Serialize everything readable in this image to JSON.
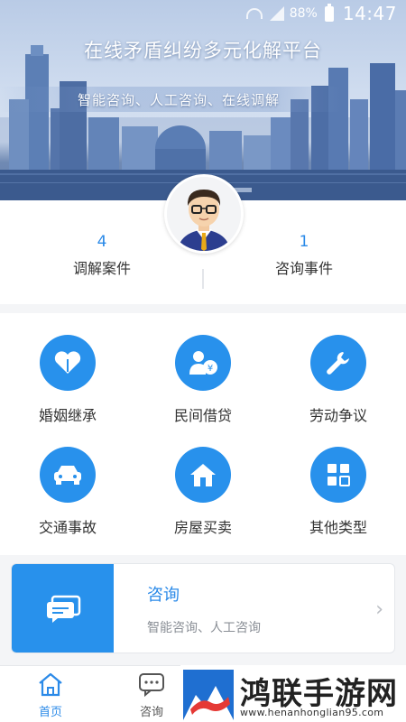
{
  "status_bar": {
    "battery_percent": "88%",
    "time": "14:47"
  },
  "hero": {
    "title": "在线矛盾纠纷多元化解平台",
    "subtitle": "智能咨询、人工咨询、在线调解"
  },
  "stats": {
    "left": {
      "value": "4",
      "label": "调解案件"
    },
    "right": {
      "value": "1",
      "label": "咨询事件"
    }
  },
  "categories": [
    {
      "label": "婚姻继承",
      "icon": "heart-icon"
    },
    {
      "label": "民间借贷",
      "icon": "user-loan-icon"
    },
    {
      "label": "劳动争议",
      "icon": "wrench-icon"
    },
    {
      "label": "交通事故",
      "icon": "car-icon"
    },
    {
      "label": "房屋买卖",
      "icon": "house-icon"
    },
    {
      "label": "其他类型",
      "icon": "grid-icon"
    }
  ],
  "consult_card": {
    "title": "咨询",
    "subtitle": "智能咨询、人工咨询",
    "chevron": "›"
  },
  "tabs": [
    {
      "label": "首页",
      "icon": "home-icon"
    },
    {
      "label": "咨询",
      "icon": "chat-icon"
    }
  ],
  "watermark": {
    "title": "鸿联手游网",
    "url": "www.henanhonglian95.com"
  },
  "colors": {
    "accent": "#2891ec",
    "accent_text": "#2b8ae8"
  }
}
